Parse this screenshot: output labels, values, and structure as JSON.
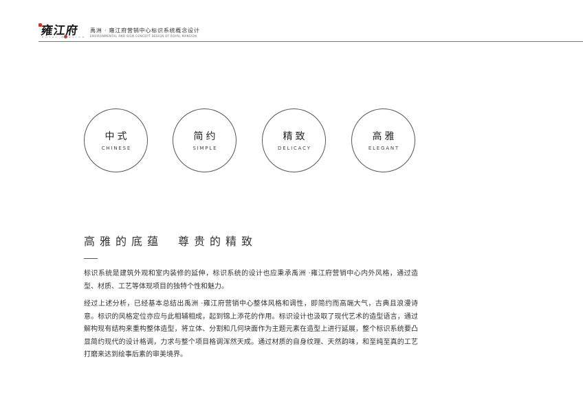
{
  "header": {
    "logo_text": "雍江府",
    "logo_sub": "ROYAL MANSION",
    "title_cn": "禹洲 · 雍江府营销中心标识系统概念设计",
    "title_en": "ENVIRONMENTAL AND SIGN CONCEPT DESIGN OF ROYAL MANSION"
  },
  "concepts": [
    {
      "cn": "中式",
      "en": "CHINESE"
    },
    {
      "cn": "简约",
      "en": "SIMPLE"
    },
    {
      "cn": "精致",
      "en": "DELICACY"
    },
    {
      "cn": "高雅",
      "en": "ELEGANT"
    }
  ],
  "section": {
    "heading_left": "高雅的底蕴",
    "heading_right": "尊贵的精致",
    "paragraph_1": "标识系统是建筑外观和室内装修的延伸，标识系统的设计也应秉承禹洲 ·雍江府营销中心内外风格，通过造型、材质、工艺等体现项目的独特个性和魅力。",
    "paragraph_2": "经过上述分析，已经基本总结出禹洲 ·雍江府营销中心整体风格和调性，即简约而高端大气，古典且浪漫诗意。标识的风格定位亦应与此相辅相成，起到锦上添花的作用。标识设计也汲取了现代艺术的造型语言，通过解构现有结构来重构整体造型，将立体、分割和几何块面作为主题元素在造型上进行延展，整个标识系统要凸显简约现代的设计格调，力求与整个项目格调浑然天成。通过材质的自身纹理、天然韵味，和至纯至真的工艺打磨来达到绘事后素的审美境界。"
  },
  "colors": {
    "accent_red": "#c43a2a",
    "rule_gray": "#777777",
    "text": "#333333"
  }
}
